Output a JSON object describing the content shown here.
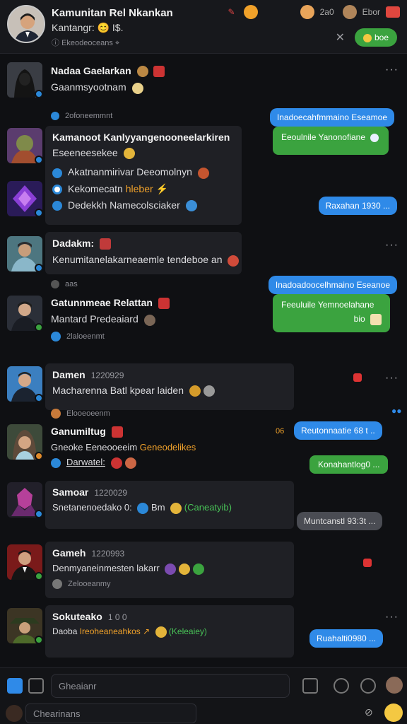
{
  "header": {
    "title": "Kamunitan Rel Nkankan",
    "subtitle": "Kantangr: 😊 I$.",
    "meta": "Ekeodeoceans",
    "right_count_1": "2a0",
    "right_count_2": "Ebor",
    "action_label": "boe"
  },
  "rows": [
    {
      "name": "Nadaa Gaelarkan",
      "msg": "Gaanmsyootnam",
      "meta": "2ofoneemmnt",
      "blue": "Inadoecahfmmaino Eseamoe"
    },
    {
      "name": "Kamanoot Kanlyyangenooneelarkiren",
      "msg": "Eseeneesekee",
      "green": "Eeoulnile Yanonofiane"
    },
    {
      "line1": "Akatnanmirivar Deeomolnyn",
      "line2a": "Kekomecatn",
      "line2b": "hleber",
      "line3": "Dedekkh Namecolsciaker",
      "blue": "Raxahan 1930 ..."
    },
    {
      "name": "Dadakm:",
      "msg": "Kenumitanelakarneaemle tendeboe an",
      "meta": "aas",
      "blue": "Inadoadoocelhmaino Eseanoe"
    },
    {
      "name": "Gatunnmeae Relattan",
      "msg": "Mantard Predeaiard",
      "meta": "2laloeenmt",
      "green": "Feeuluile Yemnoelahane",
      "green2": "bio"
    },
    {
      "name": "Damen",
      "time": "1220929",
      "msg": "Macharenna Batl kpear laiden",
      "meta": "Elooeoeenm"
    },
    {
      "name": "Ganumiltug",
      "msg": "Gneoke Eeneooeeim",
      "msg_orange": "Geneodelikes",
      "meta": "Darwatel:",
      "orange_count": "06",
      "blue": "Reutonnaatie 68 t ..",
      "green": "Konahantlog0 ..."
    },
    {
      "name": "Samoar",
      "time": "1220029",
      "msg": "Snetanenoedako 0:",
      "msg2": "Bm",
      "msg_green": "(Caneatyib)",
      "gray": "Muntcanstl 93:3t ..."
    },
    {
      "name": "Gameh",
      "time": "1220993",
      "msg": "Denmyaneinmesten lakarr",
      "meta": "Zelooeanmy"
    },
    {
      "name": "Sokuteako",
      "time": "1 0 0",
      "msg": "Daoba",
      "msg_orange": "Ireoheaneahkos",
      "msg_green": "(Keleaiey)",
      "blue": "Ruahalti0980 ..."
    }
  ],
  "footer": {
    "input_placeholder": "Gheaianr",
    "input2_placeholder": "Chearinans"
  }
}
